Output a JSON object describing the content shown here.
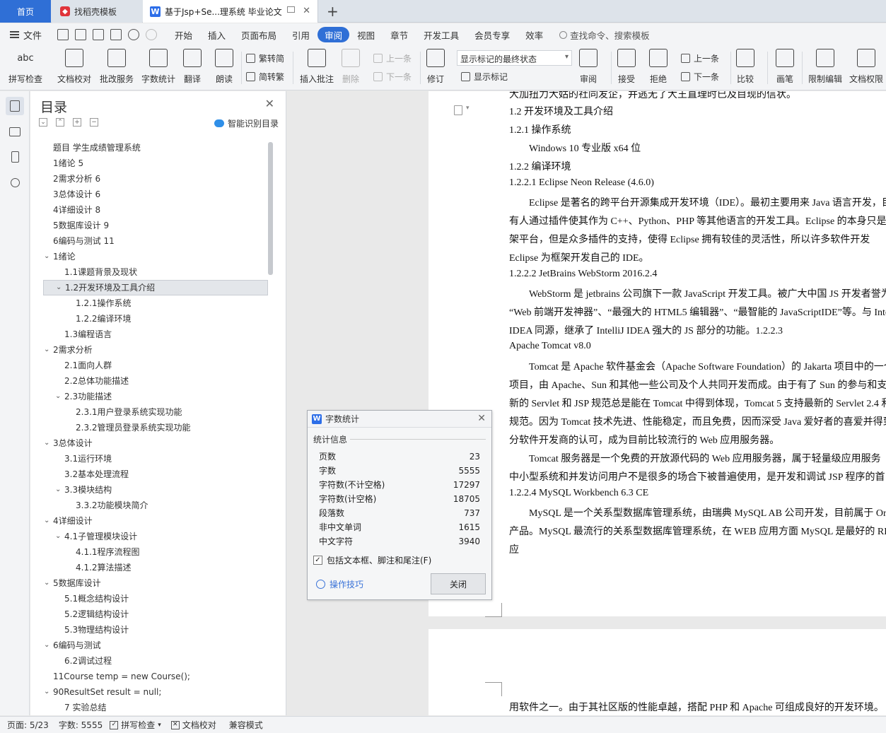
{
  "tabs": {
    "home": "首页",
    "template": "找稻壳模板",
    "document": "基于Jsp+Se...理系统 毕业论文"
  },
  "menu": {
    "file": "文件",
    "items": [
      "开始",
      "插入",
      "页面布局",
      "引用",
      "审阅",
      "视图",
      "章节",
      "开发工具",
      "会员专享",
      "效率"
    ],
    "active": "审阅",
    "search": "查找命令、搜索模板"
  },
  "ribbon": {
    "spellcheck": "拼写检查",
    "proofread": "文档校对",
    "batch": "批改服务",
    "wordcount": "字数统计",
    "translate": "翻译",
    "read": "朗读",
    "trad_to_simp": "繁转简",
    "simp_to_trad": "简转繁",
    "insert_comment": "插入批注",
    "delete": "删除",
    "prev": "上一条",
    "next": "下一条",
    "revise": "修订",
    "markup_select": "显示标记的最终状态",
    "show_markup": "显示标记",
    "review": "审阅",
    "accept": "接受",
    "reject": "拒绝",
    "prev2": "上一条",
    "next2": "下一条",
    "compare": "比较",
    "pen": "画笔",
    "restrict": "限制编辑",
    "permission": "文档权限"
  },
  "toc": {
    "title": "目录",
    "smart": "智能识别目录",
    "items": [
      "题目  学生成绩管理系统",
      "1绪论  5",
      "2需求分析  6",
      "3总体设计  6",
      "4详细设计  8",
      "5数据库设计  9",
      "6编码与测试  11",
      "1绪论",
      "1.1课题背景及现状",
      "1.2开发环境及工具介绍",
      "1.2.1操作系统",
      "1.2.2编译环境",
      "1.3编程语言",
      "2需求分析",
      "2.1面向人群",
      "2.2总体功能描述",
      "2.3功能描述",
      "2.3.1用户登录系统实现功能",
      "2.3.2管理员登录系统实现功能",
      "3总体设计",
      "3.1运行环境",
      "3.2基本处理流程",
      "3.3模块结构",
      "3.3.2功能模块简介",
      "4详细设计",
      "4.1子管理模块设计",
      "4.1.1程序流程图",
      "4.1.2算法描述",
      "5数据库设计",
      "5.1概念结构设计",
      "5.2逻辑结构设计",
      "5.3物理结构设计",
      "6编码与测试",
      "6.2调试过程",
      "11Course temp = new Course();",
      "90ResultSet result = null;",
      "7 实验总结"
    ]
  },
  "document": {
    "lines": [
      "大加扭力大姑的社同发企，并逃无了大王直理时已及目现的信状。",
      "1.2  开发环境及工具介绍",
      "1.2.1 操作系统",
      "Windows 10 专业版 x64 位",
      "1.2.2 编译环境",
      "1.2.2.1 Eclipse Neon Release (4.6.0)",
      "Eclipse 是著名的跨平台开源集成开发环境（IDE）。最初主要用来 Java 语言开发，目",
      "有人通过插件使其作为 C++、Python、PHP 等其他语言的开发工具。Eclipse 的本身只是一",
      "架平台，但是众多插件的支持，使得 Eclipse 拥有较佳的灵活性，所以许多软件开发",
      "Eclipse 为框架开发自己的 IDE。",
      "1.2.2.2 JetBrains WebStorm 2016.2.4",
      "WebStorm 是 jetbrains 公司旗下一款 JavaScript 开发工具。被广大中国 JS 开发者誉为",
      "“Web 前端开发神器”、“最强大的 HTML5 编辑器”、“最智能的 JavaScriptIDE”等。与 IntelliJ",
      "IDEA 同源，继承了 IntelliJ IDEA 强大的 JS 部分的功能。1.2.2.3",
      "Apache Tomcat v8.0",
      "Tomcat 是 Apache 软件基金会（Apache Software Foundation）的 Jakarta 项目中的一个",
      "项目，由 Apache、Sun 和其他一些公司及个人共同开发而成。由于有了 Sun 的参与和支持",
      "新的 Servlet 和 JSP 规范总是能在 Tomcat 中得到体现，Tomcat 5 支持最新的 Servlet 2.4 和 JS",
      "规范。因为 Tomcat 技术先进、性能稳定，而且免费，因而深受 Java 爱好者的喜爱并得到",
      "分软件开发商的认可，成为目前比较流行的 Web 应用服务器。",
      "Tomcat 服务器是一个免费的开放源代码的 Web 应用服务器，属于轻量级应用服务",
      "中小型系统和并发访问用户不是很多的场合下被普遍使用，是开发和调试 JSP 程序的首",
      "1.2.2.4 MySQL  Workbench 6.3 CE",
      "MySQL 是一个关系型数据库管理系统，由瑞典 MySQL AB 公司开发，目前属于 Oracle",
      "产品。MySQL 最流行的关系型数据库管理系统，在 WEB 应用方面 MySQL 是最好的 RD",
      "应"
    ],
    "page2_line": "用软件之一。由于其社区版的性能卓越，搭配 PHP 和 Apache 可组成良好的开发环境。"
  },
  "dialog": {
    "title": "字数统计",
    "group": "统计信息",
    "stats": [
      {
        "label": "页数",
        "value": "23"
      },
      {
        "label": "字数",
        "value": "5555"
      },
      {
        "label": "字符数(不计空格)",
        "value": "17297"
      },
      {
        "label": "字符数(计空格)",
        "value": "18705"
      },
      {
        "label": "段落数",
        "value": "737"
      },
      {
        "label": "非中文单词",
        "value": "1615"
      },
      {
        "label": "中文字符",
        "value": "3940"
      }
    ],
    "checkbox": "包括文本框、脚注和尾注(F)",
    "tips": "操作技巧",
    "close": "关闭"
  },
  "status": {
    "page": "页面: 5/23",
    "words": "字数: 5555",
    "spell": "拼写检查",
    "proof": "文档校对",
    "compat": "兼容模式"
  },
  "colors": {
    "accent": "#2f6fd6",
    "word_icon": "#2d6ee8",
    "template_icon": "#e0343a"
  }
}
